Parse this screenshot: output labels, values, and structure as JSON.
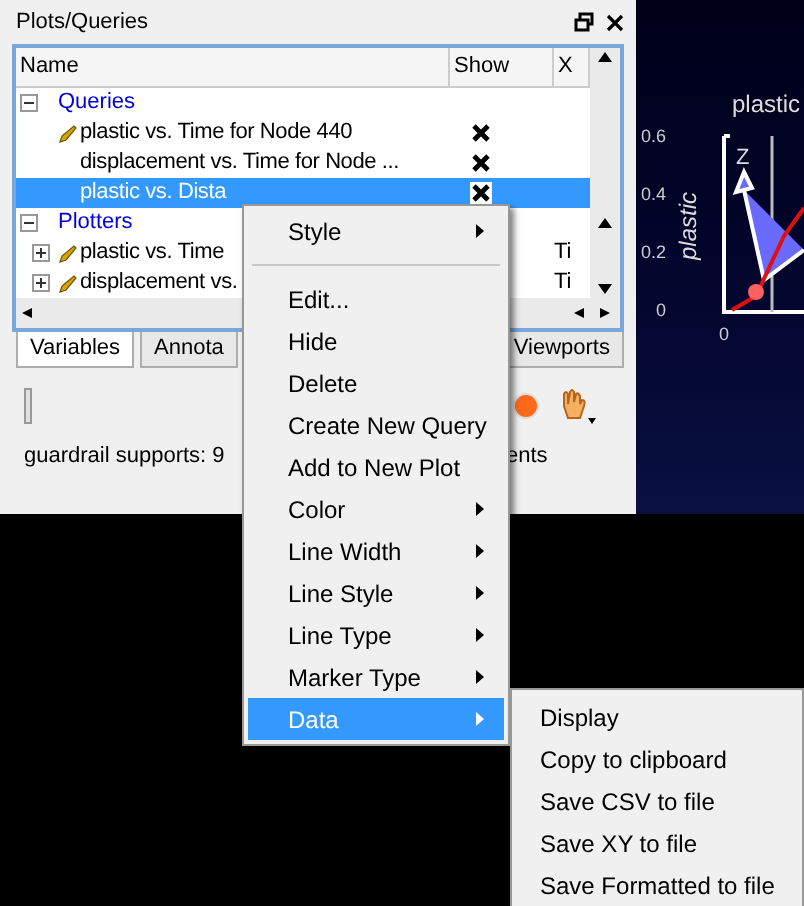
{
  "panel": {
    "title": "Plots/Queries"
  },
  "tree": {
    "columns": [
      "Name",
      "Show",
      "X"
    ],
    "groups": [
      {
        "label": "Queries",
        "expanded": true,
        "items": [
          {
            "kind": "query",
            "label": "plastic vs. Time for Node 440",
            "editable": true,
            "shown": true,
            "selected": false
          },
          {
            "kind": "query",
            "label": "displacement vs. Time for Node ...",
            "editable": false,
            "shown": true,
            "selected": false
          },
          {
            "kind": "query",
            "label": "plastic vs. Dista",
            "editable": false,
            "shown": true,
            "selected": true
          }
        ]
      },
      {
        "label": "Plotters",
        "expanded": true,
        "items": [
          {
            "kind": "plot",
            "label": "plastic vs. Time",
            "editable": true,
            "expanded": false,
            "x": "Ti",
            "selected": false
          },
          {
            "kind": "plot",
            "label": "displacement vs.",
            "editable": true,
            "expanded": false,
            "x": "Ti",
            "selected": false
          }
        ]
      }
    ]
  },
  "tabs": [
    {
      "label": "Variables",
      "selected": true
    },
    {
      "label": "Annota",
      "selected": false
    },
    {
      "label": "Viewports",
      "selected": false
    }
  ],
  "status": [
    "guardrail supports: 9",
    "ents"
  ],
  "plot": {
    "title": "plastic",
    "ylabel": "plastic",
    "yticks": [
      "0.6",
      "0.4",
      "0.2",
      "0"
    ],
    "xtick": "0",
    "axis": "Z"
  },
  "context_menu": [
    {
      "kind": "item",
      "label": "Style",
      "submenu": true,
      "selected": false
    },
    {
      "kind": "separator"
    },
    {
      "kind": "item",
      "label": "Edit...",
      "submenu": false,
      "selected": false
    },
    {
      "kind": "item",
      "label": "Hide",
      "submenu": false,
      "selected": false
    },
    {
      "kind": "item",
      "label": "Delete",
      "submenu": false,
      "selected": false
    },
    {
      "kind": "item",
      "label": "Create New Query",
      "submenu": false,
      "selected": false
    },
    {
      "kind": "item",
      "label": "Add to New Plot",
      "submenu": false,
      "selected": false
    },
    {
      "kind": "item",
      "label": "Color",
      "submenu": true,
      "selected": false
    },
    {
      "kind": "item",
      "label": "Line Width",
      "submenu": true,
      "selected": false
    },
    {
      "kind": "item",
      "label": "Line Style",
      "submenu": true,
      "selected": false
    },
    {
      "kind": "item",
      "label": "Line Type",
      "submenu": true,
      "selected": false
    },
    {
      "kind": "item",
      "label": "Marker Type",
      "submenu": true,
      "selected": false
    },
    {
      "kind": "item",
      "label": "Data",
      "submenu": true,
      "selected": true
    }
  ],
  "submenu": [
    "Display",
    "Copy to clipboard",
    "Save CSV to file",
    "Save XY to file",
    "Save Formatted to file"
  ]
}
